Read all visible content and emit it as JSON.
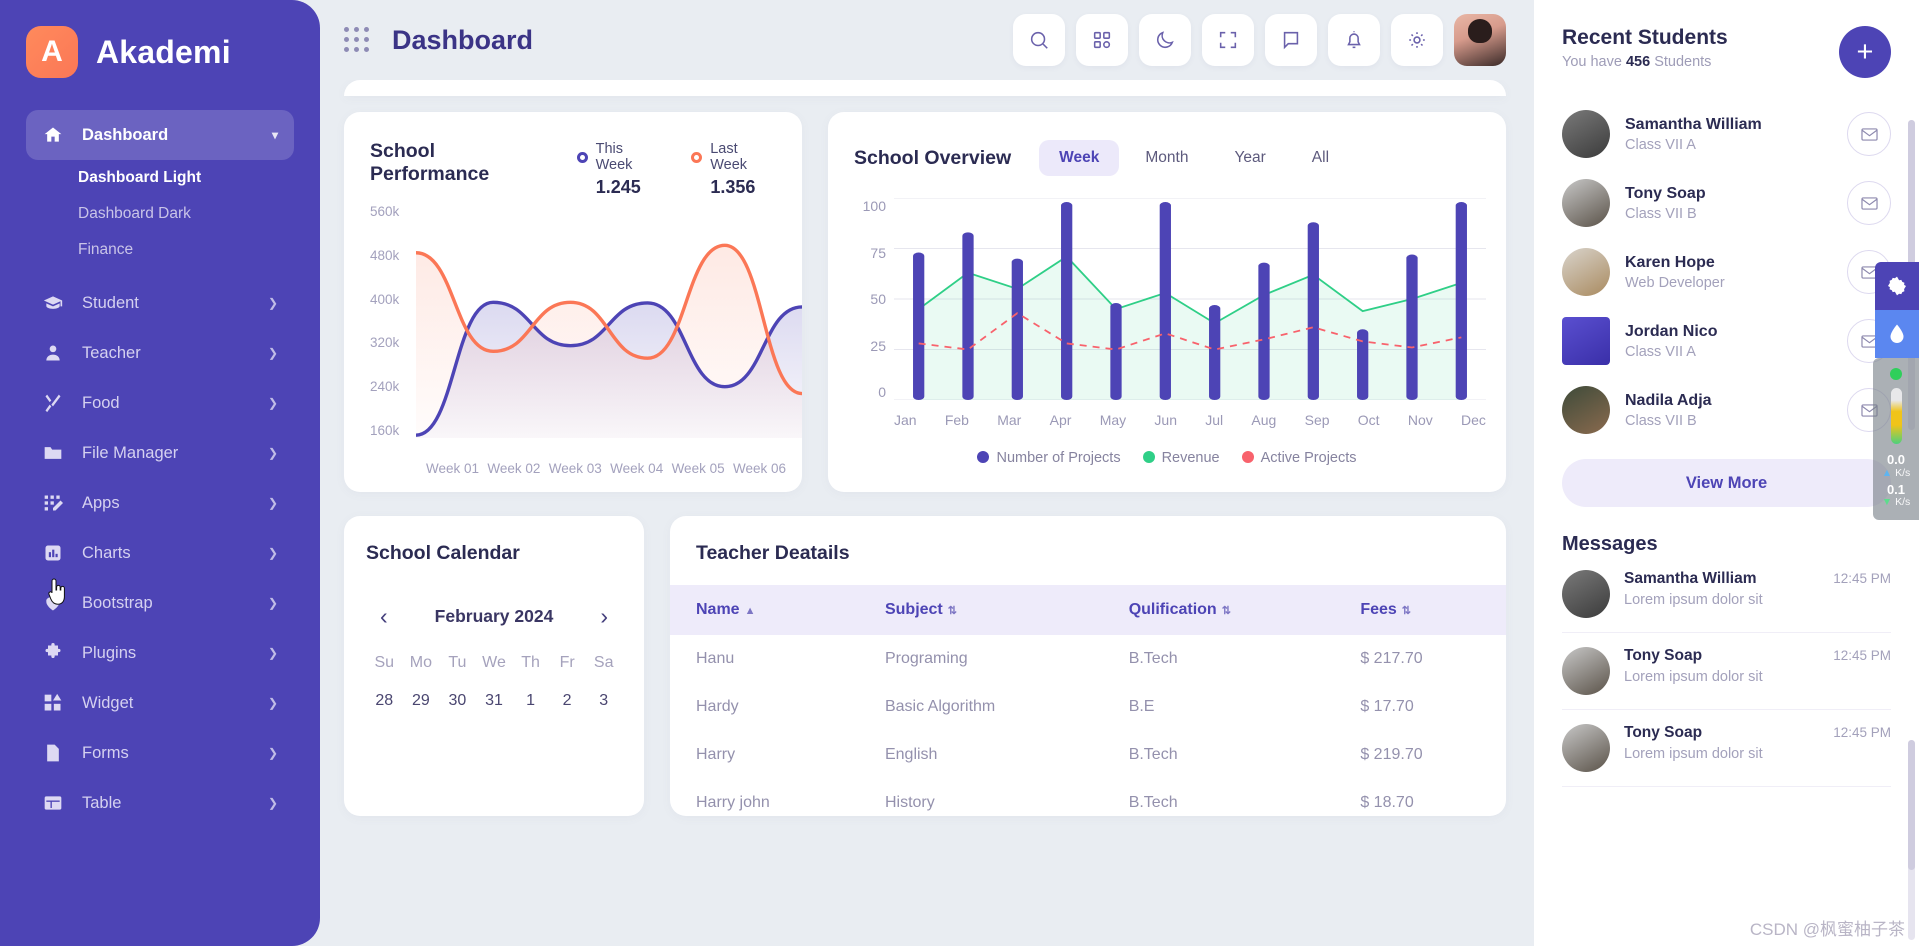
{
  "brand": {
    "initial": "A",
    "name": "Akademi",
    "logo_color": "#fb7756",
    "sidebar_color": "#4d44b5"
  },
  "sidebar": {
    "items": [
      {
        "label": "Dashboard",
        "icon": "home-icon",
        "active": true,
        "caret": "⌄",
        "children": [
          {
            "label": "Dashboard Light",
            "selected": true
          },
          {
            "label": "Dashboard Dark",
            "selected": false
          },
          {
            "label": "Finance",
            "selected": false
          }
        ]
      },
      {
        "label": "Student",
        "icon": "graduation-cap-icon",
        "caret": "❯"
      },
      {
        "label": "Teacher",
        "icon": "person-icon",
        "caret": "❯"
      },
      {
        "label": "Food",
        "icon": "cutlery-icon",
        "caret": "❯"
      },
      {
        "label": "File Manager",
        "icon": "folder-icon",
        "caret": "❯"
      },
      {
        "label": "Apps",
        "icon": "apps-grid-icon",
        "caret": "❯"
      },
      {
        "label": "Charts",
        "icon": "bar-chart-icon",
        "caret": "❯"
      },
      {
        "label": "Bootstrap",
        "icon": "heart-icon",
        "caret": "❯"
      },
      {
        "label": "Plugins",
        "icon": "puzzle-icon",
        "caret": "❯"
      },
      {
        "label": "Widget",
        "icon": "widget-icon",
        "caret": "❯"
      },
      {
        "label": "Forms",
        "icon": "document-icon",
        "caret": "❯"
      },
      {
        "label": "Table",
        "icon": "table-icon",
        "caret": "❯"
      }
    ]
  },
  "header": {
    "title": "Dashboard",
    "actions": [
      "search-icon",
      "apps-grid-icon",
      "moon-icon",
      "fullscreen-icon",
      "chat-icon",
      "bell-icon",
      "gear-icon"
    ]
  },
  "performance": {
    "title": "School Performance",
    "legend": [
      {
        "label": "This Week",
        "value": "1.245",
        "color": "#4d44b5"
      },
      {
        "label": "Last Week",
        "value": "1.356",
        "color": "#fb7756"
      }
    ]
  },
  "overview": {
    "title": "School Overview",
    "tabs": [
      {
        "label": "Week",
        "active": true
      },
      {
        "label": "Month",
        "active": false
      },
      {
        "label": "Year",
        "active": false
      },
      {
        "label": "All",
        "active": false
      }
    ]
  },
  "calendar": {
    "title": "School Calendar",
    "month": "February 2024",
    "prev": "‹",
    "next": "›",
    "dow": [
      "Su",
      "Mo",
      "Tu",
      "We",
      "Th",
      "Fr",
      "Sa"
    ],
    "days": [
      "28",
      "29",
      "30",
      "31",
      "1",
      "2",
      "3"
    ]
  },
  "teachers": {
    "title": "Teacher Deatails",
    "columns": [
      {
        "label": "Name",
        "sort": "▲"
      },
      {
        "label": "Subject",
        "sort": "⇅"
      },
      {
        "label": "Qulification",
        "sort": "⇅"
      },
      {
        "label": "Fees",
        "sort": "⇅"
      }
    ],
    "rows": [
      {
        "name": "Hanu",
        "subject": "Programing",
        "qualification": "B.Tech",
        "fees": "$ 217.70"
      },
      {
        "name": "Hardy",
        "subject": "Basic Algorithm",
        "qualification": "B.E",
        "fees": "$ 17.70"
      },
      {
        "name": "Harry",
        "subject": "English",
        "qualification": "B.Tech",
        "fees": "$ 219.70"
      },
      {
        "name": "Harry john",
        "subject": "History",
        "qualification": "B.Tech",
        "fees": "$ 18.70"
      }
    ]
  },
  "recent_students": {
    "title": "Recent Students",
    "subtitle_pre": "You have ",
    "count": "456",
    "subtitle_post": " Students",
    "add_label": "+",
    "view_more": "View More",
    "students": [
      {
        "name": "Samantha William",
        "meta": "Class VII A",
        "avatar_colors": [
          "#7a7a7a",
          "#3b3b3b"
        ]
      },
      {
        "name": "Tony Soap",
        "meta": "Class VII B",
        "avatar_colors": [
          "#c8c8c8",
          "#5a5248"
        ]
      },
      {
        "name": "Karen Hope",
        "meta": "Web Developer",
        "avatar_colors": [
          "#d9d4cc",
          "#a98a5f"
        ]
      },
      {
        "name": "Jordan Nico",
        "meta": "Class VII A",
        "avatar_colors": [
          "#5a4fd0",
          "#3a2fa8"
        ],
        "square": true
      },
      {
        "name": "Nadila Adja",
        "meta": "Class VII B",
        "avatar_colors": [
          "#3e4b3a",
          "#8a6a4e"
        ]
      }
    ]
  },
  "messages": {
    "title": "Messages",
    "items": [
      {
        "name": "Samantha William",
        "time": "12:45 PM",
        "text": "Lorem ipsum dolor sit",
        "avatar_colors": [
          "#7a7a7a",
          "#3b3b3b"
        ]
      },
      {
        "name": "Tony Soap",
        "time": "12:45 PM",
        "text": "Lorem ipsum dolor sit",
        "avatar_colors": [
          "#c8c8c8",
          "#5a5248"
        ]
      },
      {
        "name": "Tony Soap",
        "time": "12:45 PM",
        "text": "Lorem ipsum dolor sit",
        "avatar_colors": [
          "#c8c8c8",
          "#5a5248"
        ]
      }
    ]
  },
  "float_widgets": {
    "settings_icon": "gear-icon",
    "theme_icon": "water-drop-icon"
  },
  "net_monitor": {
    "upload": "0.0",
    "upload_unit": "K/s",
    "download": "0.1",
    "download_unit": "K/s"
  },
  "watermark": "CSDN @枫蜜柚子茶",
  "chart_data": [
    {
      "type": "area",
      "title": "School Performance",
      "x": [
        "Week 01",
        "Week 02",
        "Week 03",
        "Week 04",
        "Week 05",
        "Week 06"
      ],
      "ylim": [
        160,
        560
      ],
      "yticks": [
        560,
        480,
        400,
        320,
        240,
        160
      ],
      "ytick_labels": [
        "560k",
        "480k",
        "400k",
        "320k",
        "240k",
        "160k"
      ],
      "grid": false,
      "legend_position": "top-right",
      "series": [
        {
          "name": "This Week",
          "color": "#4d44b5",
          "values": [
            165,
            398,
            322,
            397,
            250,
            390
          ]
        },
        {
          "name": "Last Week",
          "color": "#fb7756",
          "values": [
            485,
            312,
            398,
            300,
            498,
            238
          ]
        }
      ]
    },
    {
      "type": "bar",
      "title": "School Overview",
      "categories": [
        "Jan",
        "Feb",
        "Mar",
        "Apr",
        "May",
        "Jun",
        "Jul",
        "Aug",
        "Sep",
        "Oct",
        "Nov",
        "Dec"
      ],
      "ylim": [
        0,
        100
      ],
      "yticks": [
        0,
        25,
        50,
        75,
        100
      ],
      "grid": true,
      "legend_position": "bottom-center",
      "series": [
        {
          "name": "Number of Projects",
          "type": "bar",
          "color": "#4d44b5",
          "values": [
            73,
            83,
            70,
            98,
            48,
            98,
            47,
            68,
            88,
            35,
            72,
            98
          ]
        },
        {
          "name": "Revenue",
          "type": "area",
          "color": "#2fcf87",
          "values": [
            45,
            63,
            55,
            71,
            45,
            53,
            38,
            52,
            62,
            44,
            50,
            58
          ]
        },
        {
          "name": "Active Projects",
          "type": "line-dashed",
          "color": "#f8626c",
          "values": [
            28,
            25,
            43,
            28,
            25,
            33,
            25,
            30,
            36,
            29,
            26,
            31
          ]
        }
      ]
    }
  ]
}
